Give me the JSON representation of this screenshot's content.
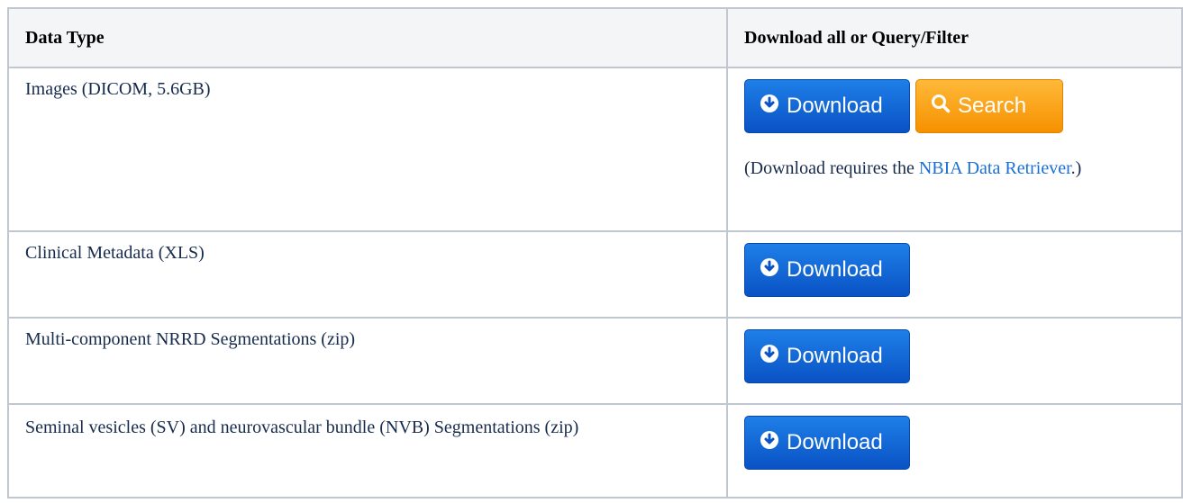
{
  "table": {
    "headers": [
      "Data Type",
      "Download all or Query/Filter"
    ],
    "rows": [
      {
        "label": "Images (DICOM, 5.6GB)",
        "download_label": "Download",
        "search_label": "Search",
        "note_prefix": "(Download requires the ",
        "note_link": "NBIA Data Retriever",
        "note_suffix": ".)"
      },
      {
        "label": "Clinical Metadata (XLS)",
        "download_label": "Download"
      },
      {
        "label": "Multi-component NRRD Segmentations (zip)",
        "download_label": "Download"
      },
      {
        "label": "Seminal vesicles (SV) and neurovascular bundle (NVB) Segmentations (zip)",
        "download_label": "Download"
      }
    ]
  },
  "colors": {
    "download_button": "#0a52c5",
    "search_button": "#f69100",
    "link": "#1a6fd6",
    "border": "#c1c7d0",
    "header_bg": "#f4f5f7"
  },
  "icons": {
    "download": "download-circle-icon",
    "search": "search-icon"
  }
}
